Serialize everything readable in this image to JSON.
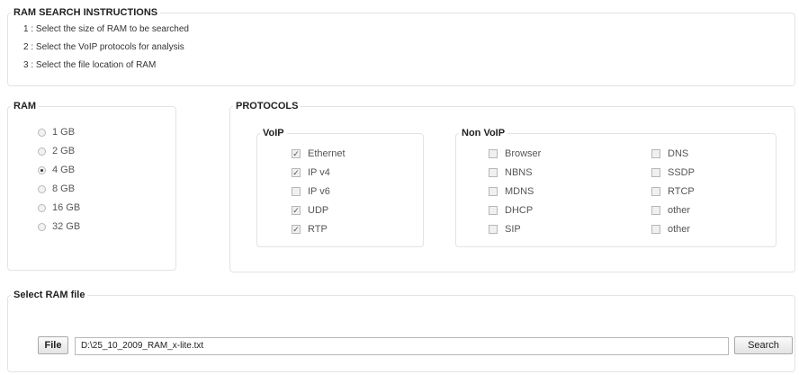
{
  "instructions": {
    "title": "RAM SEARCH INSTRUCTIONS",
    "steps": [
      "1 : Select the size of RAM to be searched",
      "2 : Select the VoIP protocols for analysis",
      "3 : Select the file location of RAM"
    ]
  },
  "ram": {
    "title": "RAM",
    "options": [
      {
        "label": "1 GB",
        "selected": false
      },
      {
        "label": "2 GB",
        "selected": false
      },
      {
        "label": "4 GB",
        "selected": true
      },
      {
        "label": "8 GB",
        "selected": false
      },
      {
        "label": "16 GB",
        "selected": false
      },
      {
        "label": "32 GB",
        "selected": false
      }
    ]
  },
  "protocols": {
    "title": "PROTOCOLS",
    "voip": {
      "title": "VoIP",
      "items": [
        {
          "label": "Ethernet",
          "checked": true
        },
        {
          "label": "IP v4",
          "checked": true
        },
        {
          "label": "IP v6",
          "checked": false
        },
        {
          "label": "UDP",
          "checked": true
        },
        {
          "label": "RTP",
          "checked": true
        }
      ]
    },
    "nonvoip": {
      "title": "Non VoIP",
      "col1": [
        {
          "label": "Browser",
          "checked": false
        },
        {
          "label": "NBNS",
          "checked": false
        },
        {
          "label": "MDNS",
          "checked": false
        },
        {
          "label": "DHCP",
          "checked": false
        },
        {
          "label": "SIP",
          "checked": false
        }
      ],
      "col2": [
        {
          "label": "DNS",
          "checked": false
        },
        {
          "label": "SSDP",
          "checked": false
        },
        {
          "label": "RTCP",
          "checked": false
        },
        {
          "label": "other",
          "checked": false
        },
        {
          "label": "other",
          "checked": false
        }
      ]
    }
  },
  "file": {
    "title": "Select RAM file",
    "file_button": "File",
    "path": "D:\\25_10_2009_RAM_x-lite.txt",
    "search_button": "Search"
  },
  "icons": {
    "checkbox": "checkbox-icon",
    "radio": "radio-icon"
  }
}
